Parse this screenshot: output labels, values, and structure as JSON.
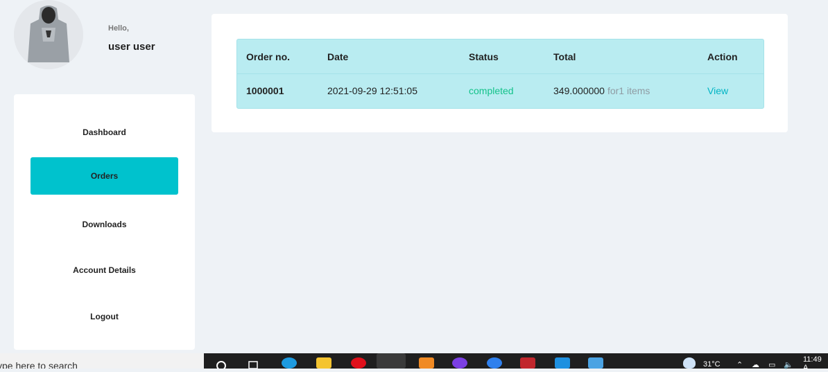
{
  "user": {
    "greeting": "Hello,",
    "name": "user user"
  },
  "menu": {
    "items": [
      {
        "label": "Dashboard"
      },
      {
        "label": "Orders",
        "active": true
      },
      {
        "label": "Downloads"
      },
      {
        "label": "Account Details"
      },
      {
        "label": "Logout"
      }
    ]
  },
  "orders": {
    "headers": [
      "Order no.",
      "Date",
      "Status",
      "Total",
      "Action"
    ],
    "rows": [
      {
        "order_no": "1000001",
        "date": "2021-09-29 12:51:05",
        "status": "completed",
        "total": "349.000000",
        "items_note": "for1 items",
        "action": "View"
      }
    ]
  },
  "taskbar": {
    "search_placeholder": "ype here to search",
    "temperature": "31°C",
    "time": "11:49 A",
    "apps": [
      "search-icon",
      "task-view-icon",
      "edge-icon",
      "file-explorer-icon",
      "opera-icon",
      "firefox-icon",
      "sublime-icon",
      "brave-icon",
      "app-icon",
      "filezilla-icon",
      "vscode-icon",
      "photos-icon"
    ]
  },
  "colors": {
    "accent": "#00c2cd",
    "table_bg": "#b9ecf1",
    "status_completed": "#13c28a",
    "link": "#00b4c4"
  }
}
